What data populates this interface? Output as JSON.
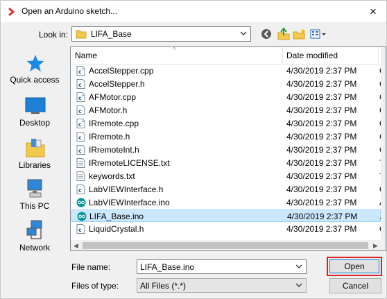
{
  "window": {
    "title": "Open an Arduino sketch...",
    "close_glyph": "×"
  },
  "toolbar": {
    "look_in_label": "Look in:",
    "look_in_value": "LIFA_Base",
    "buttons": [
      "back-icon",
      "up-folder-icon",
      "new-folder-icon",
      "view-menu-icon"
    ]
  },
  "places": [
    {
      "label": "Quick access",
      "icon": "star-icon"
    },
    {
      "label": "Desktop",
      "icon": "desktop-icon"
    },
    {
      "label": "Libraries",
      "icon": "libraries-icon"
    },
    {
      "label": "This PC",
      "icon": "computer-icon"
    },
    {
      "label": "Network",
      "icon": "network-icon"
    }
  ],
  "filelist": {
    "columns": {
      "name": "Name",
      "date": "Date modified"
    },
    "files": [
      {
        "name": "AccelStepper.cpp",
        "date": "4/30/2019 2:37 PM",
        "type": "C",
        "icon": "cpp-file-icon"
      },
      {
        "name": "AccelStepper.h",
        "date": "4/30/2019 2:37 PM",
        "type": "C",
        "icon": "c-header-file-icon"
      },
      {
        "name": "AFMotor.cpp",
        "date": "4/30/2019 2:37 PM",
        "type": "C",
        "icon": "cpp-file-icon"
      },
      {
        "name": "AFMotor.h",
        "date": "4/30/2019 2:37 PM",
        "type": "C",
        "icon": "c-header-file-icon"
      },
      {
        "name": "IRremote.cpp",
        "date": "4/30/2019 2:37 PM",
        "type": "C",
        "icon": "cpp-file-icon"
      },
      {
        "name": "IRremote.h",
        "date": "4/30/2019 2:37 PM",
        "type": "C",
        "icon": "c-header-file-icon"
      },
      {
        "name": "IRremoteInt.h",
        "date": "4/30/2019 2:37 PM",
        "type": "C",
        "icon": "c-header-file-icon"
      },
      {
        "name": "IRremoteLICENSE.txt",
        "date": "4/30/2019 2:37 PM",
        "type": "T",
        "icon": "text-file-icon"
      },
      {
        "name": "keywords.txt",
        "date": "4/30/2019 2:37 PM",
        "type": "T",
        "icon": "text-file-icon"
      },
      {
        "name": "LabVIEWInterface.h",
        "date": "4/30/2019 2:37 PM",
        "type": "C",
        "icon": "c-header-file-icon"
      },
      {
        "name": "LabVIEWInterface.ino",
        "date": "4/30/2019 2:37 PM",
        "type": "A",
        "icon": "arduino-file-icon"
      },
      {
        "name": "LIFA_Base.ino",
        "date": "4/30/2019 2:37 PM",
        "type": "A",
        "icon": "arduino-file-icon",
        "selected": true
      },
      {
        "name": "LiquidCrystal.h",
        "date": "4/30/2019 2:37 PM",
        "type": "C",
        "icon": "c-header-file-icon"
      }
    ]
  },
  "footer": {
    "file_name_label": "File name:",
    "file_name_value": "LIFA_Base.ino",
    "files_of_type_label": "Files of type:",
    "files_of_type_value": "All Files (*.*)",
    "open_label": "Open",
    "cancel_label": "Cancel"
  },
  "colors": {
    "selection": "#cce8ff",
    "highlight_border": "#e02020",
    "arduino": "#00979c"
  }
}
